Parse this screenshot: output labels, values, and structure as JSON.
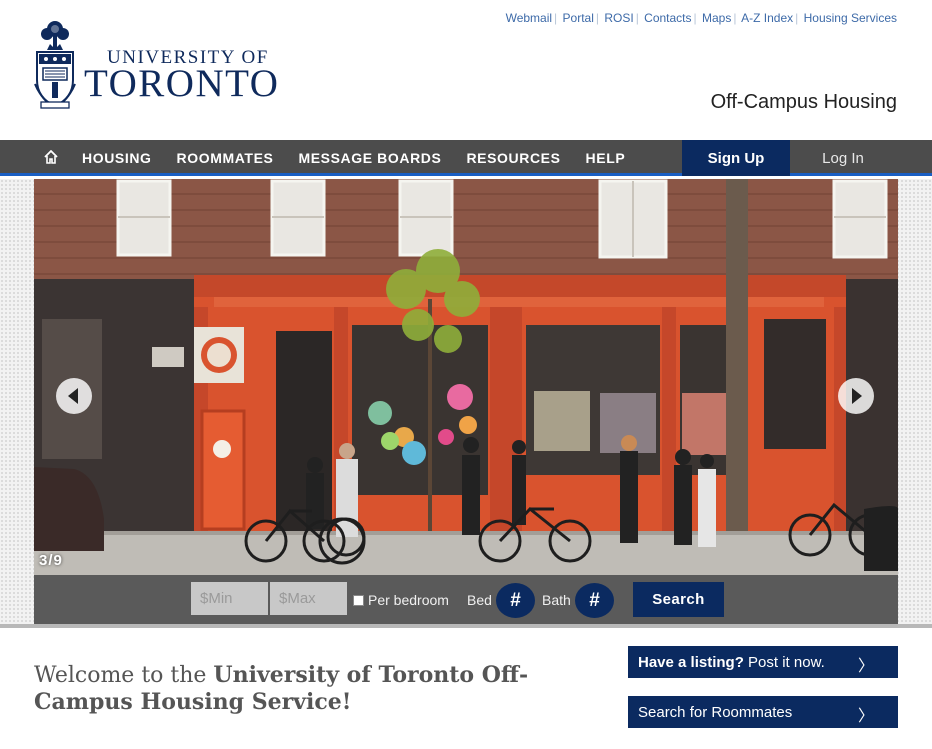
{
  "utility_links": [
    "Webmail",
    "Portal",
    "ROSI",
    "Contacts",
    "Maps",
    "A-Z Index",
    "Housing Services"
  ],
  "logo": {
    "line1": "UNIVERSITY OF",
    "line2": "TORONTO"
  },
  "site_name": "Off-Campus Housing",
  "nav": {
    "home_icon": "home-icon",
    "items": [
      "HOUSING",
      "ROOMMATES",
      "MESSAGE BOARDS",
      "RESOURCES",
      "HELP"
    ],
    "signup": "Sign Up",
    "login": "Log In"
  },
  "slideshow": {
    "counter": "3/9",
    "prev_icon": "chevron-left-icon",
    "next_icon": "chevron-right-icon"
  },
  "search": {
    "min_placeholder": "$Min",
    "max_placeholder": "$Max",
    "per_bedroom_label": "Per bedroom",
    "per_bedroom_checked": false,
    "bed_label": "Bed",
    "bed_value": "#",
    "bath_label": "Bath",
    "bath_value": "#",
    "button": "Search"
  },
  "welcome": {
    "prefix": "Welcome to the ",
    "emphasis": "University of Toronto Off-Campus Housing Service!"
  },
  "cta": {
    "listing_bold": "Have a listing?",
    "listing_rest": " Post it now.",
    "roommates": "Search for Roommates",
    "chevron": "〉"
  },
  "colors": {
    "navy": "#0b2a60",
    "nav_bg": "#4c4c4c",
    "nav_border": "#1a5fc4",
    "link": "#3d6aa8",
    "brick": "#d9532e"
  }
}
